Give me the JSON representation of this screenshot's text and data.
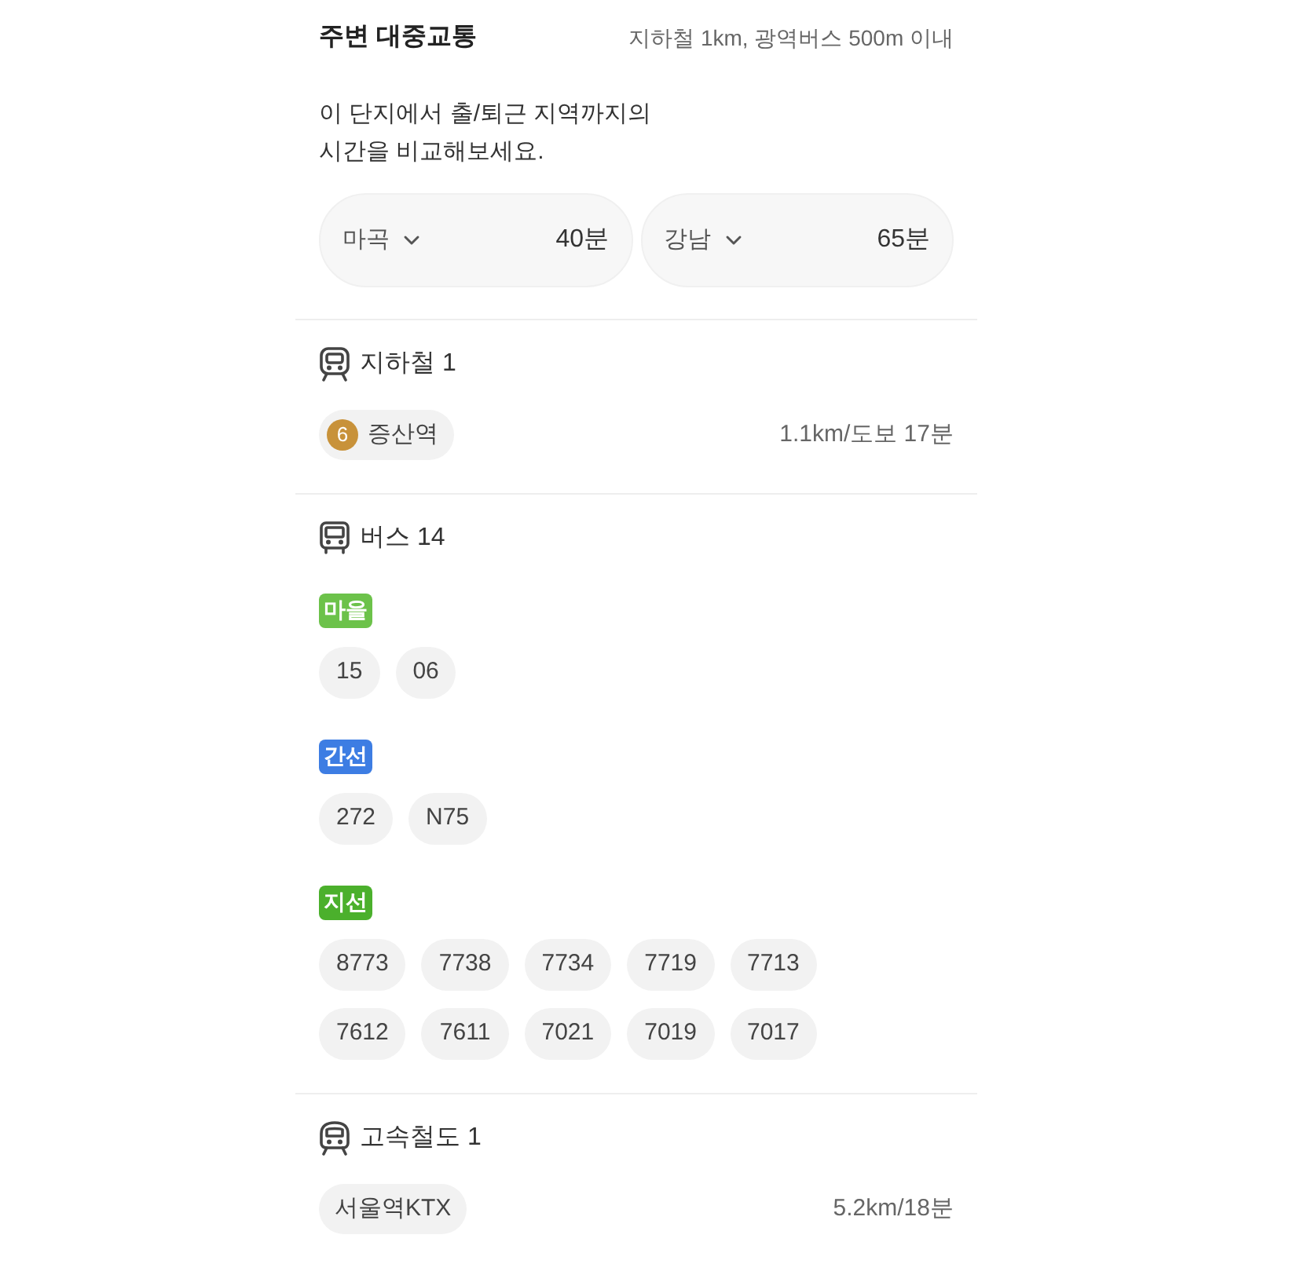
{
  "header": {
    "title": "주변 대중교통",
    "subtitle": "지하철 1km, 광역버스 500m 이내"
  },
  "commute": {
    "description": "이 단지에서 출/퇴근 지역까지의\n시간을 비교해보세요.",
    "destinations": [
      {
        "name": "마곡",
        "time": "40분"
      },
      {
        "name": "강남",
        "time": "65분"
      }
    ]
  },
  "sections": [
    {
      "kind": "subway",
      "title": "지하철 1",
      "stations": [
        {
          "line": "6",
          "color": "#c8923a",
          "name": "증산역",
          "distance": "1.1km/도보 17분"
        }
      ]
    },
    {
      "kind": "bus",
      "title": "버스 14",
      "groups": [
        {
          "type": "마을",
          "color": "#6cc24a",
          "routes": [
            "15",
            "06"
          ]
        },
        {
          "type": "간선",
          "color": "#3d7de3",
          "routes": [
            "272",
            "N75"
          ]
        },
        {
          "type": "지선",
          "color": "#4bb02c",
          "routes": [
            "8773",
            "7738",
            "7734",
            "7719",
            "7713",
            "7612",
            "7611",
            "7021",
            "7019",
            "7017"
          ]
        }
      ]
    },
    {
      "kind": "rail",
      "title": "고속철도 1",
      "stations": [
        {
          "name": "서울역KTX",
          "distance": "5.2km/18분"
        }
      ]
    }
  ]
}
